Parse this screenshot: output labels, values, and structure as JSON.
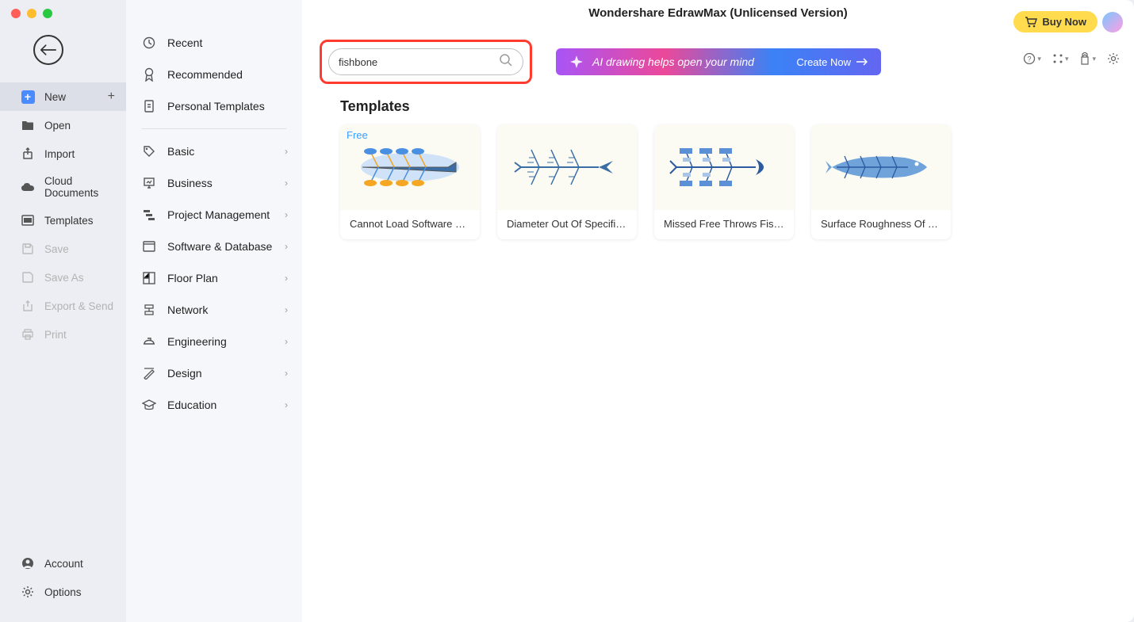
{
  "app_title": "Wondershare EdrawMax (Unlicensed Version)",
  "topbar": {
    "buy_now": "Buy Now"
  },
  "search": {
    "value": "fishbone"
  },
  "ai_banner": {
    "text": "AI drawing helps open your mind",
    "cta": "Create Now"
  },
  "leftnav": {
    "new": "New",
    "open": "Open",
    "import": "Import",
    "cloud": "Cloud Documents",
    "templates": "Templates",
    "save": "Save",
    "save_as": "Save As",
    "export": "Export & Send",
    "print": "Print",
    "account": "Account",
    "options": "Options"
  },
  "categories": {
    "recent": "Recent",
    "recommended": "Recommended",
    "personal": "Personal Templates",
    "basic": "Basic",
    "business": "Business",
    "project": "Project Management",
    "software": "Software & Database",
    "floor": "Floor Plan",
    "network": "Network",
    "engineering": "Engineering",
    "design": "Design",
    "education": "Education"
  },
  "templates_heading": "Templates",
  "templates": [
    {
      "label": "Cannot Load Software On A PC",
      "free": true
    },
    {
      "label": "Diameter Out Of Specification",
      "free": false
    },
    {
      "label": "Missed Free Throws Fishbone",
      "free": false
    },
    {
      "label": "Surface Roughness Of The Part",
      "free": false
    }
  ]
}
